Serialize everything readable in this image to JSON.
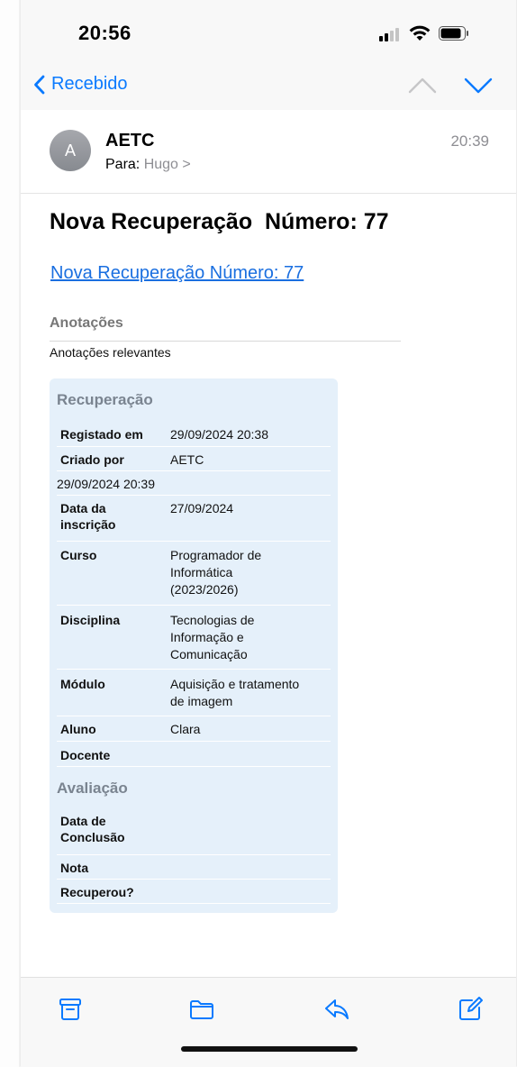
{
  "status": {
    "time": "20:56"
  },
  "nav": {
    "back_label": "Recebido"
  },
  "message": {
    "avatar_initial": "A",
    "sender": "AETC",
    "to_prefix": "Para:",
    "to_name": "Hugo >",
    "time": "20:39"
  },
  "body": {
    "subject": "Nova Recuperação  Número: 77",
    "subject_link": "Nova Recuperação Número: 77",
    "annotations_heading": "Anotações",
    "annotations_text": "Anotações relevantes"
  },
  "card": {
    "section_recuperacao": "Recuperação",
    "section_avaliacao": "Avaliação",
    "rows": {
      "registado": {
        "label": "Registado em",
        "value": "29/09/2024 20:38"
      },
      "criado": {
        "label": "Criado por",
        "value": "AETC"
      },
      "timestamp": "29/09/2024 20:39",
      "inscricao": {
        "label_1": "Data da",
        "label_2": "inscrição",
        "value": "27/09/2024"
      },
      "curso": {
        "label": "Curso",
        "value_1": "Programador de",
        "value_2": "Informática",
        "value_3": "(2023/2026)"
      },
      "disciplina": {
        "label": "Disciplina",
        "value_1": "Tecnologias de",
        "value_2": "Informação e",
        "value_3": "Comunicação"
      },
      "modulo": {
        "label": "Módulo",
        "value_1": "Aquisição e tratamento",
        "value_2": "de imagem"
      },
      "aluno": {
        "label": "Aluno",
        "value": "Clara"
      },
      "docente": {
        "label": "Docente",
        "value": ""
      },
      "conclusao": {
        "label_1": "Data de",
        "label_2": "Conclusão",
        "value": ""
      },
      "nota": {
        "label": "Nota",
        "value": ""
      },
      "recuperou": {
        "label": "Recuperou?",
        "value": ""
      }
    }
  },
  "colors": {
    "accent": "#0a7aff",
    "link": "#1a6fe0",
    "card_bg": "#e5f0fa",
    "muted": "#8e8e93"
  },
  "toolbar_icons": [
    "archive-icon",
    "folder-icon",
    "reply-icon",
    "compose-icon"
  ]
}
